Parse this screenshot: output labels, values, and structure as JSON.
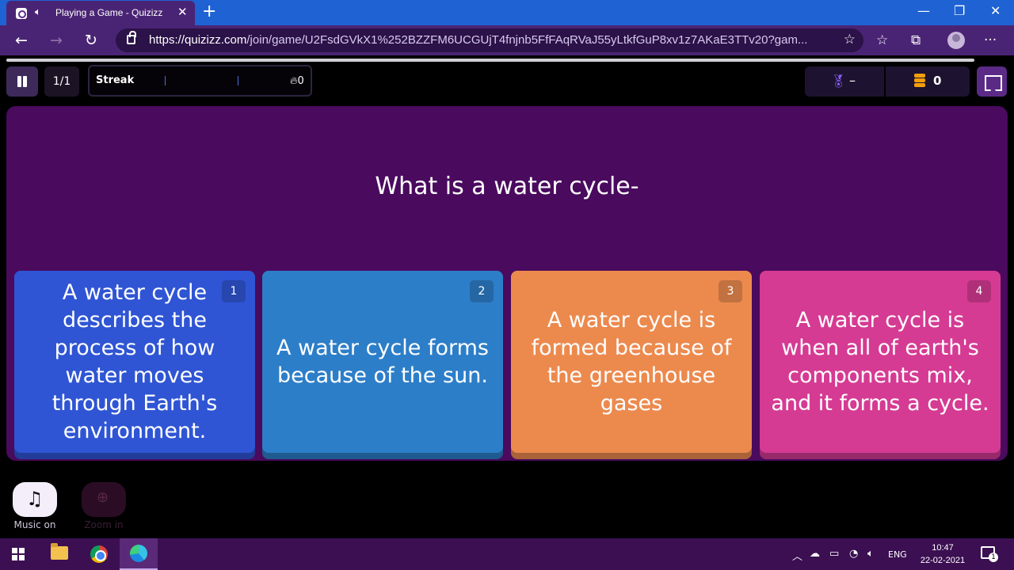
{
  "browser": {
    "tab_title": "Playing a Game - Quizizz",
    "tab_close": "✕",
    "new_tab": "+",
    "url_domain": "https://quizizz.com",
    "url_path": "/join/game/U2FsdGVkX1%252BZZFM6UCGUjT4fnjnb5FfFAqRVaJ55yLtkfGuP8xv1z7AKaE3TTv20?gam..."
  },
  "game": {
    "question_counter": "1/1",
    "streak_label": "Streak",
    "streak_count": "0",
    "rank_value": "–",
    "coins": "0",
    "question": "What is a water cycle-",
    "options": [
      {
        "number": "1",
        "text": "A water cycle describes the process of how water moves through Earth's environment.",
        "color": "#2f55d4"
      },
      {
        "number": "2",
        "text": "A water cycle forms because of the sun.",
        "color": "#2d7ec8"
      },
      {
        "number": "3",
        "text": "A water cycle is formed because of the greenhouse gases",
        "color": "#ec8a4e"
      },
      {
        "number": "4",
        "text": "A water cycle is when all of earth's components mix, and it forms a cycle.",
        "color": "#d53b93"
      }
    ]
  },
  "controls": {
    "music_label": "Music on",
    "zoom_label": "Zoom in"
  },
  "taskbar": {
    "language": "ENG",
    "time": "10:47",
    "date": "22-02-2021",
    "notification_count": "1"
  }
}
